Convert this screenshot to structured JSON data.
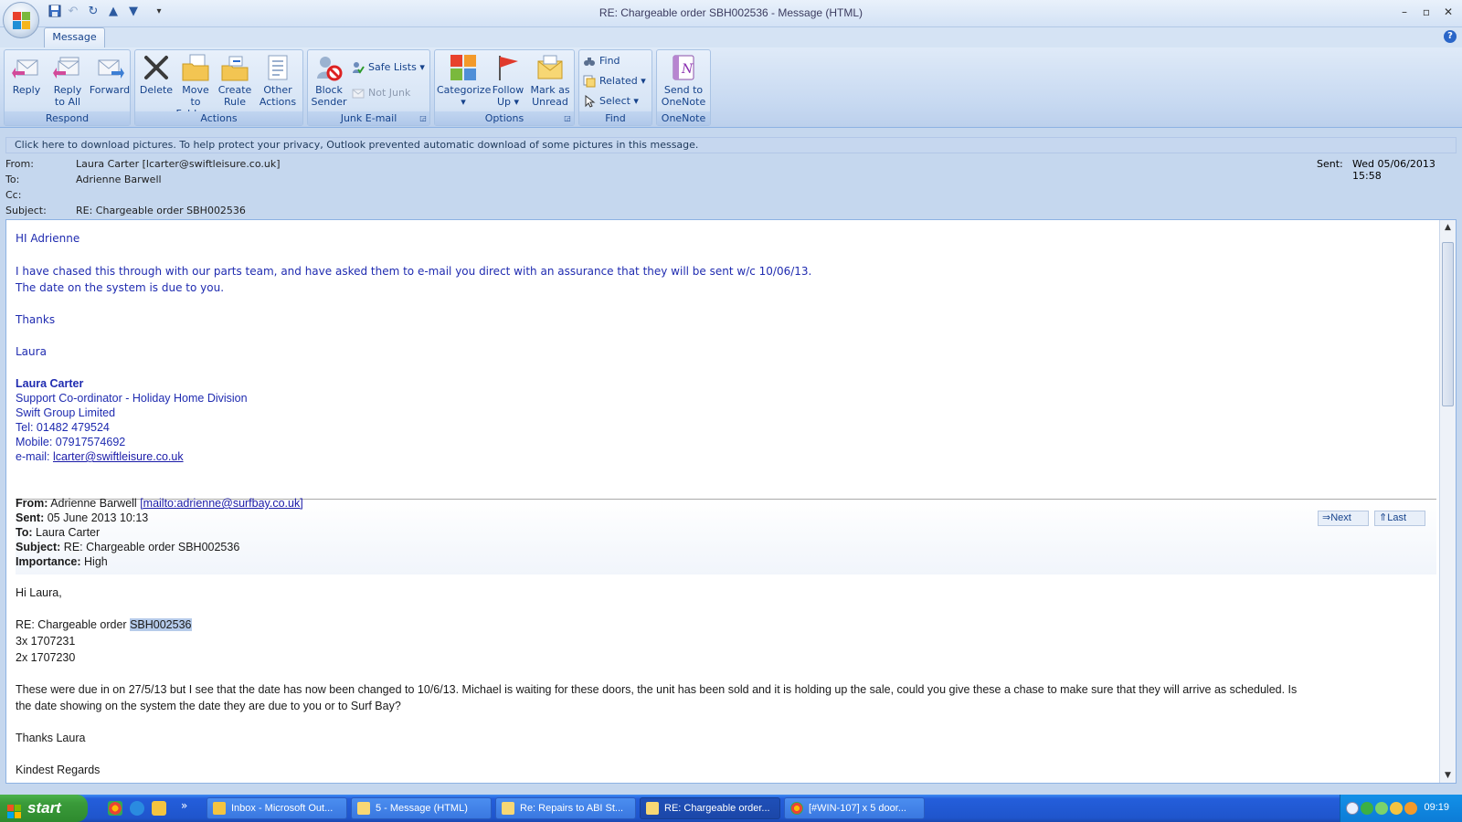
{
  "window": {
    "title": "RE: Chargeable order SBH002536 - Message (HTML)",
    "minimize": "–",
    "restore": "▫",
    "close": "✕"
  },
  "quick_access": {
    "save_icon": "save-icon",
    "undo_icon": "undo-icon",
    "redo_icon": "redo-icon",
    "up_icon": "previous-item-icon",
    "down_icon": "next-item-icon",
    "customize_glyph": "▾"
  },
  "ribbon": {
    "tab": "Message",
    "help": "?",
    "groups": {
      "respond": "Respond",
      "actions": "Actions",
      "junk": "Junk E-mail",
      "options": "Options",
      "find": "Find",
      "onenote": "OneNote"
    },
    "buttons": {
      "reply": [
        "Reply",
        ""
      ],
      "reply_all": [
        "Reply",
        "to All"
      ],
      "forward": [
        "Forward",
        ""
      ],
      "delete": [
        "Delete",
        ""
      ],
      "move_to_folder": [
        "Move to",
        "Folder ▾"
      ],
      "create_rule": [
        "Create",
        "Rule"
      ],
      "other_actions": [
        "Other",
        "Actions ▾"
      ],
      "block_sender": [
        "Block",
        "Sender"
      ],
      "safe_lists": "Safe Lists ▾",
      "not_junk": "Not Junk",
      "categorize": [
        "Categorize",
        "▾"
      ],
      "follow_up": [
        "Follow",
        "Up ▾"
      ],
      "mark_unread": [
        "Mark as",
        "Unread"
      ],
      "find": "Find",
      "related": "Related ▾",
      "select": "Select ▾",
      "send_onenote": [
        "Send to",
        "OneNote"
      ]
    }
  },
  "infobar": "Click here to download pictures. To help protect your privacy, Outlook prevented automatic download of some pictures in this message.",
  "header": {
    "from_label": "From:",
    "from_value": "Laura Carter [lcarter@swiftleisure.co.uk]",
    "to_label": "To:",
    "to_value": "Adrienne Barwell",
    "cc_label": "Cc:",
    "cc_value": "",
    "subject_label": "Subject:",
    "subject_value": "RE: Chargeable order SBH002536",
    "sent_label": "Sent:",
    "sent_value": "Wed 05/06/2013 15:58"
  },
  "body": {
    "greeting": "HI Adrienne",
    "para1_line1": "I have chased this through with our parts team, and have asked them to e-mail you direct with an assurance that they will be sent w/c 10/06/13.",
    "para1_line2": "The date on the system is due to you.",
    "thanks": "Thanks",
    "name": "Laura",
    "sig_name": "Laura Carter",
    "sig_title": "Support Co-ordinator - Holiday Home Division",
    "sig_company": "Swift Group Limited",
    "sig_tel": "Tel: 01482 479524",
    "sig_mobile": "Mobile: 07917574692",
    "sig_email_prefix": "e-mail: ",
    "sig_email": "lcarter@swiftleisure.co.uk",
    "fwd_from_label": "From:",
    "fwd_from_name": "Adrienne Barwell ",
    "fwd_from_link": "[mailto:adrienne@surfbay.co.uk]",
    "fwd_sent_label": "Sent:",
    "fwd_sent_value": "05 June 2013 10:13",
    "fwd_to_label": "To:",
    "fwd_to_value": "Laura Carter",
    "fwd_subject_label": "Subject:",
    "fwd_subject_value": "RE: Chargeable order SBH002536",
    "fwd_importance_label": "Importance:",
    "fwd_importance_value": "High",
    "nav_next": "Next",
    "nav_last": "Last",
    "hi": "Hi Laura,",
    "re_prefix": "RE: Chargeable order ",
    "re_order": "SBH002536",
    "item1": "3x  1707231",
    "item2": "2x 1707230",
    "para2_line1": "These were due in on 27/5/13 but I see that the date has now been changed to 10/6/13.  Michael is waiting for these doors, the unit has been sold and it is holding up the sale,  could you give these a chase to make sure that they will arrive as scheduled.  Is",
    "para2_line2": "the date showing on the system the date they are due to you or to Surf Bay?",
    "thanks_laura": "Thanks Laura",
    "kind_regards": "Kindest Regards"
  },
  "taskbar": {
    "start": "start",
    "tasks": [
      "Inbox - Microsoft Out...",
      "5 - Message (HTML)",
      "Re: Repairs to ABI St...",
      "RE: Chargeable order...",
      "[#WIN-107] x 5 door..."
    ],
    "overflow": "»",
    "clock": "09:19"
  },
  "colors": {
    "ribbon_text": "#15428b",
    "email_text": "#1f2bb0",
    "taskbar": "#245edb",
    "start_green": "#3a9b3a"
  }
}
